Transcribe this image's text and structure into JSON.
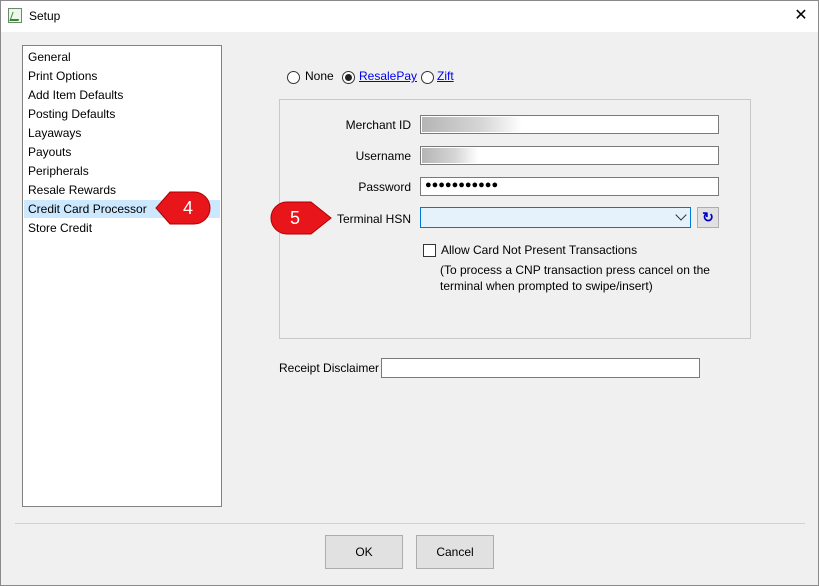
{
  "window": {
    "title": "Setup"
  },
  "nav": {
    "items": [
      {
        "label": "General",
        "selected": false
      },
      {
        "label": "Print Options",
        "selected": false
      },
      {
        "label": "Add Item Defaults",
        "selected": false
      },
      {
        "label": "Posting Defaults",
        "selected": false
      },
      {
        "label": "Layaways",
        "selected": false
      },
      {
        "label": "Payouts",
        "selected": false
      },
      {
        "label": "Peripherals",
        "selected": false
      },
      {
        "label": "Resale Rewards",
        "selected": false
      },
      {
        "label": "Credit Card Processor",
        "selected": true
      },
      {
        "label": "Store Credit",
        "selected": false
      }
    ]
  },
  "processor": {
    "options": [
      {
        "label": "None",
        "checked": false,
        "link": false
      },
      {
        "label": "ResalePay",
        "checked": true,
        "link": true
      },
      {
        "label": "Zift",
        "checked": false,
        "link": true
      }
    ]
  },
  "fields": {
    "merchant_id_label": "Merchant ID",
    "username_label": "Username",
    "password_label": "Password",
    "password_value": "●●●●●●●●●●●",
    "terminal_hsn_label": "Terminal HSN",
    "terminal_hsn_value": "",
    "allow_cnp_label": "Allow Card Not Present Transactions",
    "allow_cnp_checked": false,
    "cnp_note_line1": "(To process a CNP transaction press cancel on the",
    "cnp_note_line2": "terminal when prompted to swipe/insert)",
    "receipt_disclaimer_label": "Receipt Disclaimer",
    "receipt_disclaimer_value": ""
  },
  "buttons": {
    "ok": "OK",
    "cancel": "Cancel"
  },
  "callouts": {
    "step4": "4",
    "step5": "5",
    "color": "#e8151b"
  }
}
